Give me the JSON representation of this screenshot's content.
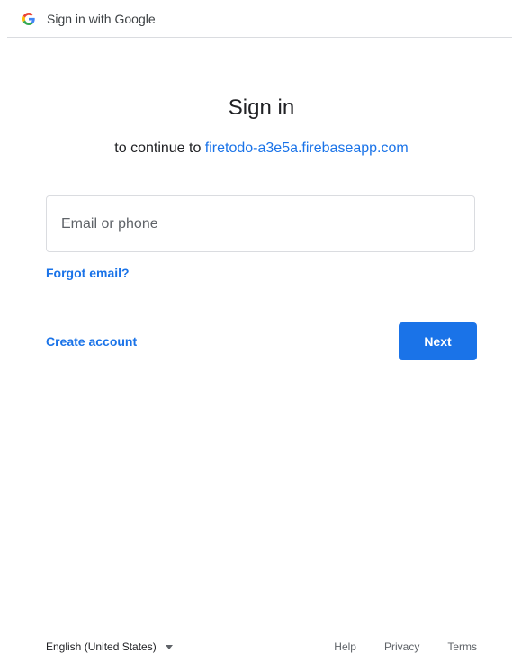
{
  "header": {
    "logo_icon": "google-g-icon",
    "title": "Sign in with Google"
  },
  "main": {
    "title": "Sign in",
    "subtitle_prefix": "to continue to ",
    "subtitle_link": "firetodo-a3e5a.firebaseapp.com",
    "email_placeholder": "Email or phone",
    "email_value": "",
    "forgot_email": "Forgot email?",
    "create_account": "Create account",
    "next_label": "Next"
  },
  "footer": {
    "language": "English (United States)",
    "help": "Help",
    "privacy": "Privacy",
    "terms": "Terms"
  },
  "colors": {
    "accent": "#1a73e8",
    "border": "#dadce0",
    "text": "#202124",
    "muted": "#5f6368"
  }
}
